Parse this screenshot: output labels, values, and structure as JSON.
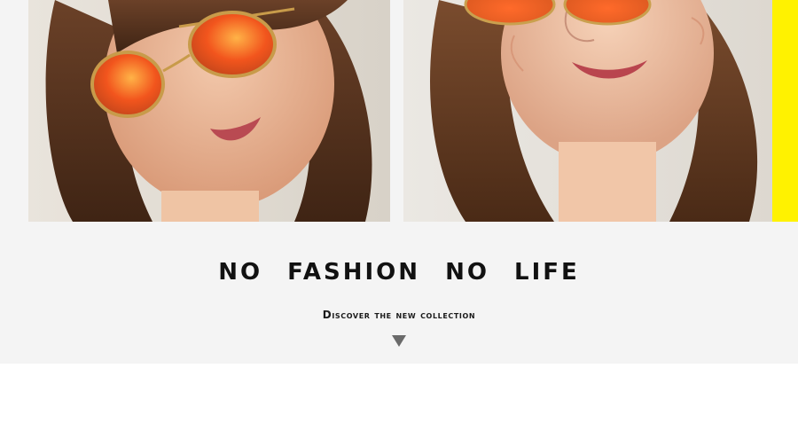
{
  "hero": {
    "headline": "NO FASHION NO LIFE",
    "subline": "Discover the new collection",
    "arrow_icon": "triangle-down-icon"
  },
  "photos": {
    "left": "woman-sunglasses-looking-down",
    "right": "woman-sunglasses-smiling"
  },
  "colors": {
    "accent": "#fff200",
    "background": "#f4f4f4",
    "text": "#111111",
    "arrow": "#6a6a6a"
  }
}
